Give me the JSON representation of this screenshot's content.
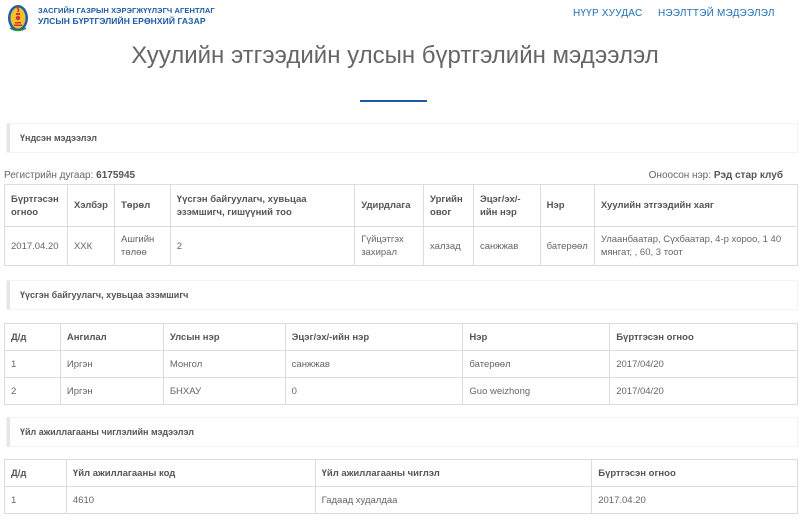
{
  "header": {
    "org_line1": "ЗАСГИЙН ГАЗРЫН ХЭРЭГЖҮҮЛЭГЧ АГЕНТЛАГ",
    "org_line2": "УЛСЫН БҮРТГЭЛИЙН ЕРӨНХИЙ ГАЗАР",
    "logo_icon": "soyombo-emblem-icon",
    "nav": {
      "home": "НҮҮР ХУУДАС",
      "contact": "НЭЭЛТТЭЙ МЭДЭЭЛЭЛ"
    }
  },
  "page": {
    "title": "Хуулийн этгээдийн улсын бүртгэлийн мэдээлэл"
  },
  "basic_info": {
    "section_title": "Үндсэн мэдээлэл",
    "reg_label": "Регистрийн дугаар:",
    "reg_value": "6175945",
    "short_label": "Оноосон нэр:",
    "short_value": "Рэд стар клуб",
    "columns": [
      "Бүртгэсэн огноо",
      "Хэлбэр",
      "Төрөл",
      "Үүсгэн байгуулагч, хувьцаа эзэмшигч, гишүүний тоо",
      "Удирдлага",
      "Ургийн овог",
      "Эцэг/эх/-ийн нэр",
      "Нэр",
      "Хуулийн этгээдийн хаяг"
    ],
    "row": {
      "reg_date": "2017.04.20",
      "form": "ХХК",
      "type": "Ашгийн төлөө",
      "founders_count": "2",
      "management": "Гүйцэтгэх захирал",
      "clan": "халзад",
      "parent_name": "санжжав",
      "name": "батерөөл",
      "address": "Улаанбаатар, Сүхбаатар, 4-р хороо, 1 40 мянгат, , 60, 3 тоот"
    }
  },
  "founders": {
    "section_title": "Үүсгэн байгуулагч, хувьцаа эзэмшигч",
    "columns": [
      "Д/д",
      "Ангилал",
      "Улсын нэр",
      "Эцэг/эх/-ийн нэр",
      "Нэр",
      "Бүртгэсэн огноо"
    ],
    "rows": [
      {
        "no": "1",
        "category": "Иргэн",
        "country": "Монгол",
        "parent_name": "санжжав",
        "name": "батерөөл",
        "date": "2017/04/20"
      },
      {
        "no": "2",
        "category": "Иргэн",
        "country": "БНХАУ",
        "parent_name": "0",
        "name": "Guo weizhong",
        "date": "2017/04/20"
      }
    ]
  },
  "activity": {
    "section_title": "Үйл ажиллагааны чиглэлийн мэдээлэл",
    "columns": [
      "Д/д",
      "Үйл ажиллагааны код",
      "Үйл ажиллагааны чиглэл",
      "Бүртгэсэн огноо"
    ],
    "rows": [
      {
        "no": "1",
        "code": "4610",
        "direction": "Гадаад худалдаа",
        "date": "2017.04.20"
      }
    ]
  }
}
